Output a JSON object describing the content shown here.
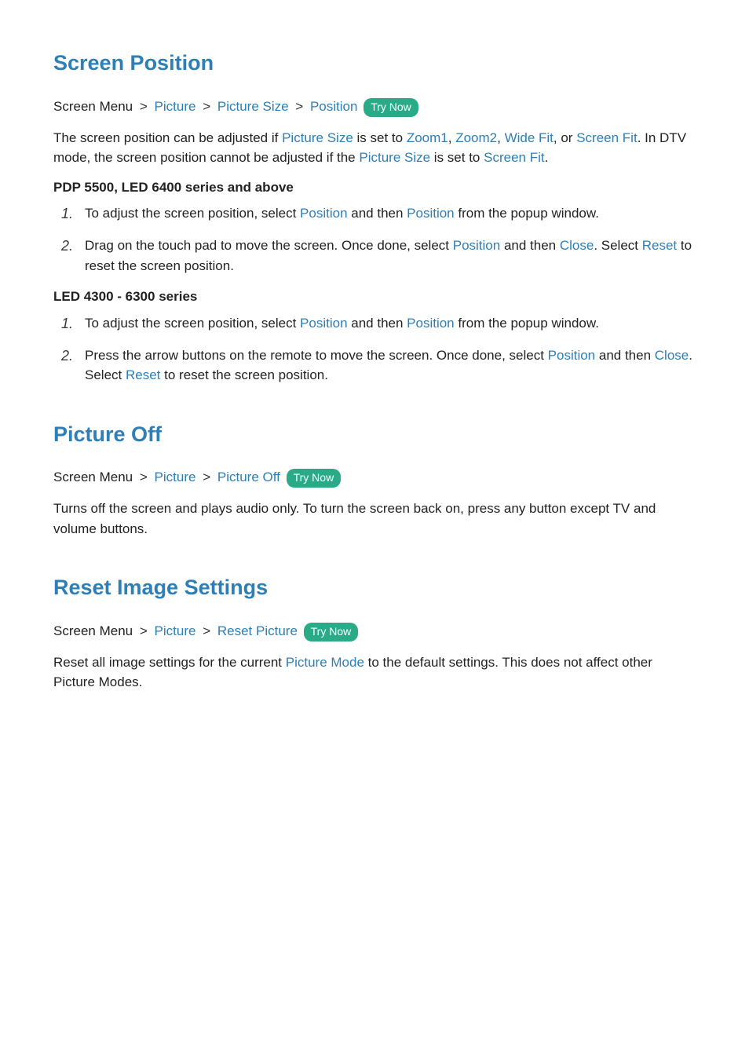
{
  "sections": {
    "screen_position": {
      "title": "Screen Position",
      "breadcrumb_start": "Screen Menu",
      "bc_picture": "Picture",
      "bc_picture_size": "Picture Size",
      "bc_position": "Position",
      "try_now": "Try Now",
      "p1_t1": "The screen position can be adjusted if ",
      "p1_picture_size": "Picture Size",
      "p1_t2": " is set to ",
      "p1_zoom1": "Zoom1",
      "p1_c1": ", ",
      "p1_zoom2": "Zoom2",
      "p1_c2": ", ",
      "p1_widefit": "Wide Fit",
      "p1_c3": ", or ",
      "p1_screenfit": "Screen Fit",
      "p1_t3": ". In DTV mode, the screen position cannot be adjusted if the ",
      "p1_picture_size2": "Picture Size",
      "p1_t4": " is set to ",
      "p1_screenfit2": "Screen Fit",
      "p1_end": ".",
      "sub1": "PDP 5500, LED 6400 series and above",
      "s1_1_a": "To adjust the screen position, select ",
      "s1_1_pos1": "Position",
      "s1_1_b": " and then ",
      "s1_1_pos2": "Position",
      "s1_1_c": " from the popup window.",
      "s1_2_a": "Drag on the touch pad to move the screen. Once done, select ",
      "s1_2_pos": "Position",
      "s1_2_b": " and then ",
      "s1_2_close": "Close",
      "s1_2_c": ". Select ",
      "s1_2_reset": "Reset",
      "s1_2_d": " to reset the screen position.",
      "sub2": "LED 4300 - 6300 series",
      "s2_1_a": "To adjust the screen position, select ",
      "s2_1_pos1": "Position",
      "s2_1_b": " and then ",
      "s2_1_pos2": "Position",
      "s2_1_c": " from the popup window.",
      "s2_2_a": "Press the arrow buttons on the remote to move the screen. Once done, select ",
      "s2_2_pos": "Position",
      "s2_2_b": " and then ",
      "s2_2_close": "Close",
      "s2_2_c": ". Select ",
      "s2_2_reset": "Reset",
      "s2_2_d": " to reset the screen position."
    },
    "picture_off": {
      "title": "Picture Off",
      "breadcrumb_start": "Screen Menu",
      "bc_picture": "Picture",
      "bc_picture_off": "Picture Off",
      "try_now": "Try Now",
      "p1": "Turns off the screen and plays audio only. To turn the screen back on, press any button except TV and volume buttons."
    },
    "reset_image": {
      "title": "Reset Image Settings",
      "breadcrumb_start": "Screen Menu",
      "bc_picture": "Picture",
      "bc_reset_picture": "Reset Picture",
      "try_now": "Try Now",
      "p1_a": "Reset all image settings for the current ",
      "p1_mode": "Picture Mode",
      "p1_b": " to the default settings. This does not affect other Picture Modes."
    }
  },
  "nums": {
    "one": "1.",
    "two": "2."
  },
  "sep": ">"
}
